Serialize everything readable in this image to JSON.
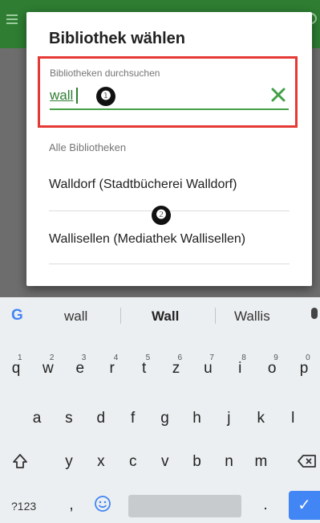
{
  "dialog": {
    "title": "Bibliothek wählen",
    "search_label": "Bibliotheken durchsuchen",
    "search_value": "wall",
    "section_label": "Alle Bibliotheken",
    "libraries": [
      {
        "label": "Walldorf (Stadtbücherei Walldorf)"
      },
      {
        "label": "Wallisellen (Mediathek Wallisellen)"
      }
    ]
  },
  "markers": [
    "❶",
    "❷"
  ],
  "keyboard": {
    "suggestions": [
      "wall",
      "Wall",
      "Wallis"
    ],
    "row1": [
      {
        "key": "q",
        "hint": "1"
      },
      {
        "key": "w",
        "hint": "2"
      },
      {
        "key": "e",
        "hint": "3"
      },
      {
        "key": "r",
        "hint": "4"
      },
      {
        "key": "t",
        "hint": "5"
      },
      {
        "key": "z",
        "hint": "6"
      },
      {
        "key": "u",
        "hint": "7"
      },
      {
        "key": "i",
        "hint": "8"
      },
      {
        "key": "o",
        "hint": "9"
      },
      {
        "key": "p",
        "hint": "0"
      }
    ],
    "row2": [
      "a",
      "s",
      "d",
      "f",
      "g",
      "h",
      "j",
      "k",
      "l"
    ],
    "row3": [
      "y",
      "x",
      "c",
      "v",
      "b",
      "n",
      "m"
    ],
    "symbols_key": "?123",
    "comma_key": ",",
    "period_key": ".",
    "google_glyph": "G",
    "enter_glyph": "✓"
  },
  "colors": {
    "accent": "#2e7d32",
    "highlight_border": "#e53935",
    "enter_key": "#4285f4"
  }
}
